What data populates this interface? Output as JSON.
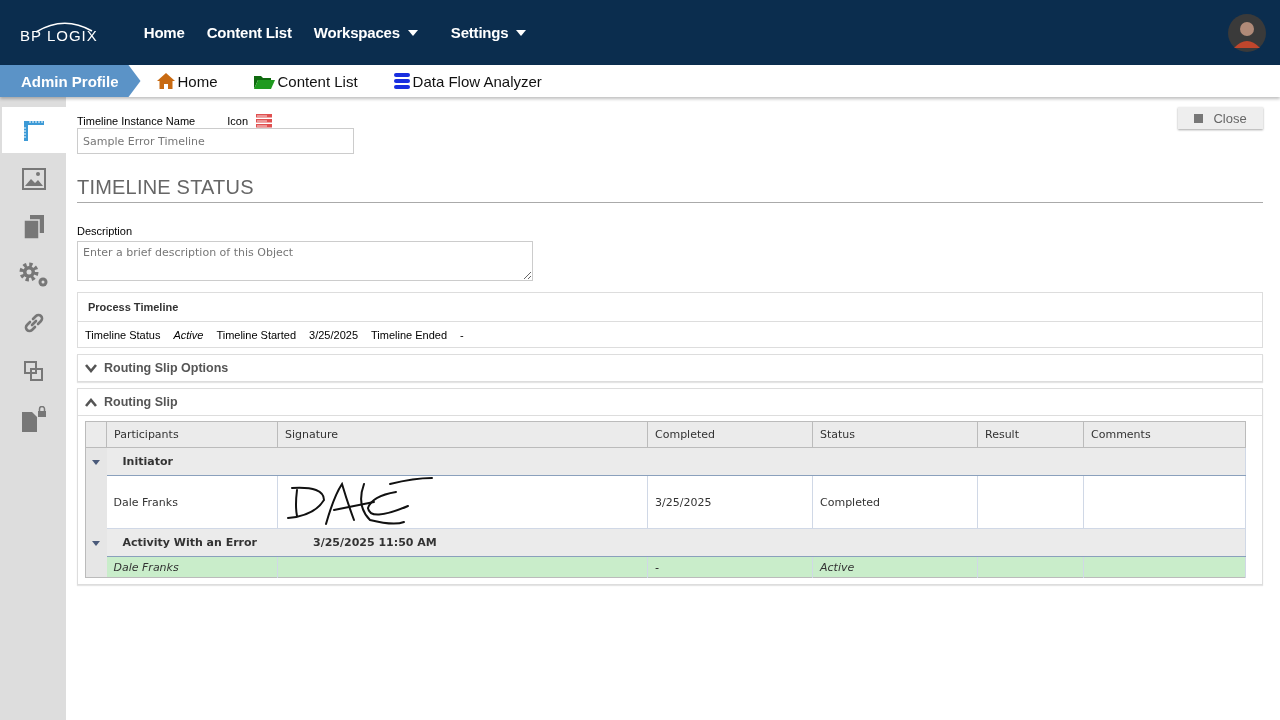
{
  "topbar": {
    "logo": "BP LOGIX",
    "menu": [
      {
        "label": "Home",
        "dropdown": false
      },
      {
        "label": "Content List",
        "dropdown": false
      },
      {
        "label": "Workspaces",
        "dropdown": true
      },
      {
        "label": "Settings",
        "dropdown": true
      }
    ]
  },
  "breadcrumb": {
    "profile": "Admin Profile",
    "links": [
      {
        "label": "Home",
        "kind": "home"
      },
      {
        "label": "Content List",
        "kind": "folder"
      },
      {
        "label": "Data Flow Analyzer",
        "kind": "database"
      }
    ]
  },
  "sidebar": {
    "items": [
      {
        "selected": true
      },
      {
        "selected": false
      },
      {
        "selected": false
      },
      {
        "selected": false
      },
      {
        "selected": false
      },
      {
        "selected": false
      },
      {
        "selected": false
      }
    ]
  },
  "form": {
    "name_label": "Timeline Instance Name",
    "icon_label": "Icon",
    "name_field": {
      "value": "Sample Error Timeline"
    },
    "close_button": "Close",
    "heading": "TIMELINE STATUS",
    "description_label": "Description",
    "description_field": {
      "placeholder": "Enter a brief description of this Object"
    }
  },
  "process_timeline": {
    "title": "Process Timeline",
    "items": [
      {
        "label": "Timeline Status",
        "value": "Active",
        "italic": true
      },
      {
        "label": "Timeline Started",
        "value": "3/25/2025",
        "italic": false
      },
      {
        "label": "Timeline Ended",
        "value": "-",
        "italic": false
      }
    ]
  },
  "sections": [
    {
      "title": "Routing Slip Options",
      "expanded": false
    },
    {
      "title": "Routing Slip",
      "expanded": true
    }
  ],
  "routing_table": {
    "columns": [
      "Participants",
      "Signature",
      "Completed",
      "Status",
      "Result",
      "Comments"
    ],
    "groups": [
      {
        "label": "Initiator",
        "expanded": true,
        "rows": [
          {
            "participant": "Dale Franks",
            "signature": true,
            "completed": "3/25/2025",
            "status": "Completed",
            "active": false
          }
        ]
      },
      {
        "label": "Activity With an Error",
        "date": "3/25/2025 11:50 AM",
        "expanded": true,
        "rows": [
          {
            "participant": "Dale Franks",
            "signature": false,
            "completed": "-",
            "status": "Active",
            "active": true
          }
        ]
      }
    ]
  }
}
